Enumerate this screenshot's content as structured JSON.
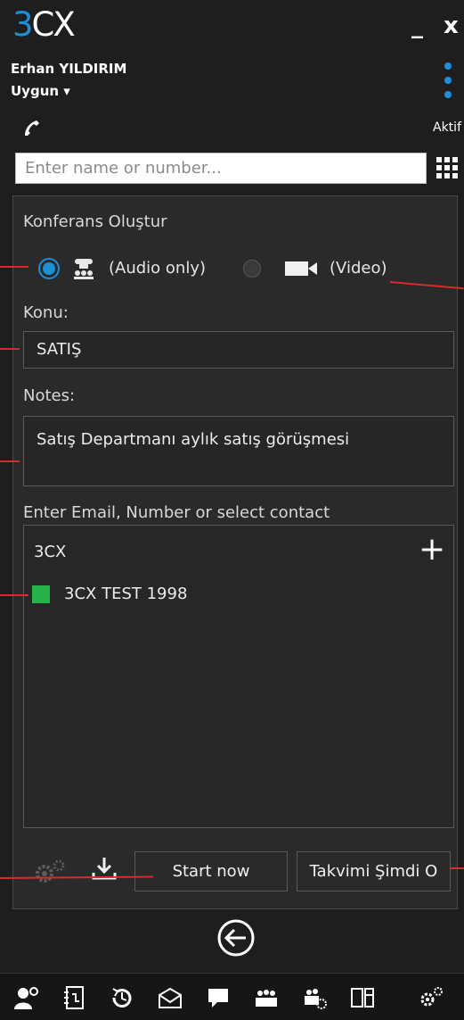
{
  "header": {
    "logo_three": "3",
    "logo_cx": "CX",
    "minimize_label": "_",
    "close_label": "x",
    "user_name": "Erhan YILDIRIM",
    "status": "Uygun ▾",
    "presence": "Aktif"
  },
  "search": {
    "placeholder": "Enter name or number..."
  },
  "conference": {
    "title": "Konferans Oluştur",
    "audio_label": "(Audio only)",
    "video_label": "(Video)",
    "selected_mode": "audio",
    "topic_label": "Konu:",
    "topic_value": "SATIŞ",
    "notes_label": "Notes:",
    "notes_value": "Satış Departmanı aylık satış görüşmesi",
    "participants_label": "Enter Email, Number or select contact",
    "group_name": "3CX",
    "add_label": "+",
    "participants": [
      {
        "name": "3CX TEST 1998",
        "color": "#27b34a"
      }
    ]
  },
  "actions": {
    "start_now": "Start now",
    "schedule": "Takvimi Şimdi O"
  },
  "bottom_icons": [
    "contacts-icon",
    "phonebook-icon",
    "history-icon",
    "voicemail-icon",
    "chat-icon",
    "conference-icon",
    "conference-settings-icon",
    "switchboard-icon",
    "settings-icon"
  ],
  "colors": {
    "accent": "#1c8fd6",
    "background": "#1e1e1e",
    "panel": "#2a2a2a",
    "callout": "#d92a2a",
    "presence_green": "#27b34a"
  }
}
